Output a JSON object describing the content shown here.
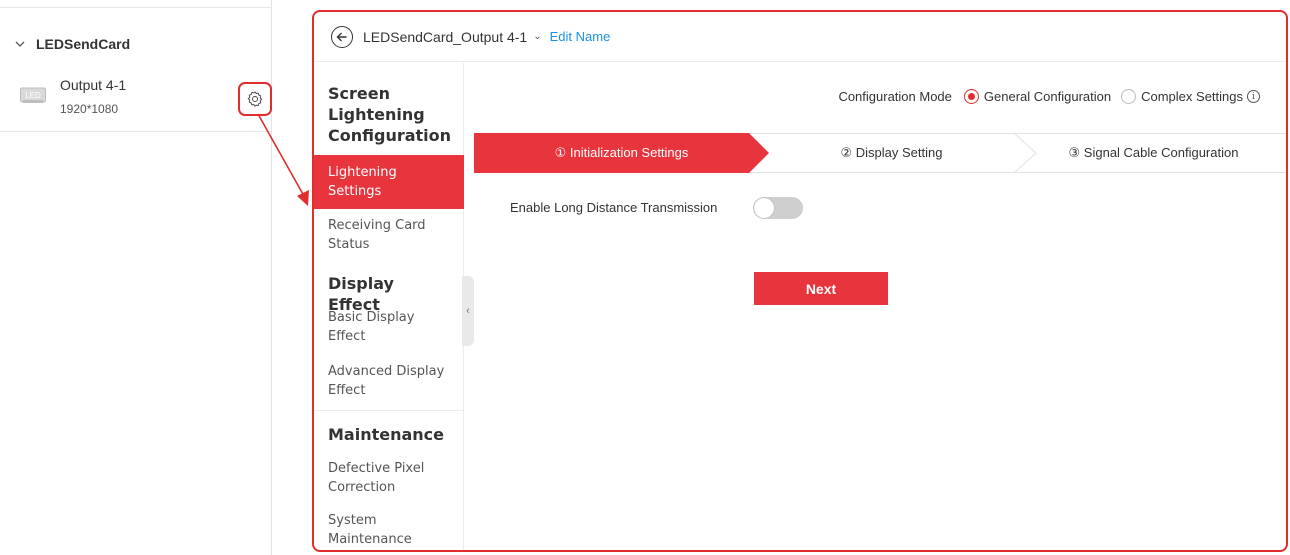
{
  "left_panel": {
    "tree_header": "LEDSendCard",
    "device": {
      "icon_text": "LED",
      "name": "Output 4-1",
      "resolution": "1920*1080"
    }
  },
  "header": {
    "title": "LEDSendCard_Output 4-1",
    "caret": "⌄",
    "edit_link": "Edit Name"
  },
  "side_menu": {
    "groups": [
      {
        "title": "Screen Lightening Configuration",
        "items": [
          "Lightening Settings",
          "Receiving Card Status"
        ]
      },
      {
        "title": "Display Effect",
        "items": [
          "Basic Display Effect",
          "Advanced Display Effect"
        ]
      },
      {
        "title": "Maintenance",
        "items": [
          "Defective Pixel Correction",
          "System Maintenance"
        ]
      }
    ],
    "active_item": "Lightening Settings",
    "collapse_glyph": "‹"
  },
  "config_mode": {
    "label": "Configuration Mode",
    "options": [
      "General Configuration",
      "Complex Settings"
    ],
    "selected": "General Configuration",
    "info_glyph": "i"
  },
  "steps": [
    {
      "label": "① Initialization Settings",
      "active": true
    },
    {
      "label": "② Display Setting",
      "active": false
    },
    {
      "label": "③ Signal Cable Configuration",
      "active": false
    }
  ],
  "form": {
    "long_distance_label": "Enable Long Distance Transmission",
    "long_distance_enabled": false,
    "next_button": "Next"
  },
  "colors": {
    "accent": "#e8343c",
    "annotation": "#e02d2d",
    "link": "#1e90e8",
    "toggle_off": "#cfcfcf"
  },
  "icons": {
    "collapse": "chevron-down-icon",
    "device": "led-icon",
    "settings": "gear-icon",
    "back": "back-arrow-icon",
    "info": "info-icon",
    "annotation": "annotation-arrow-icon"
  }
}
